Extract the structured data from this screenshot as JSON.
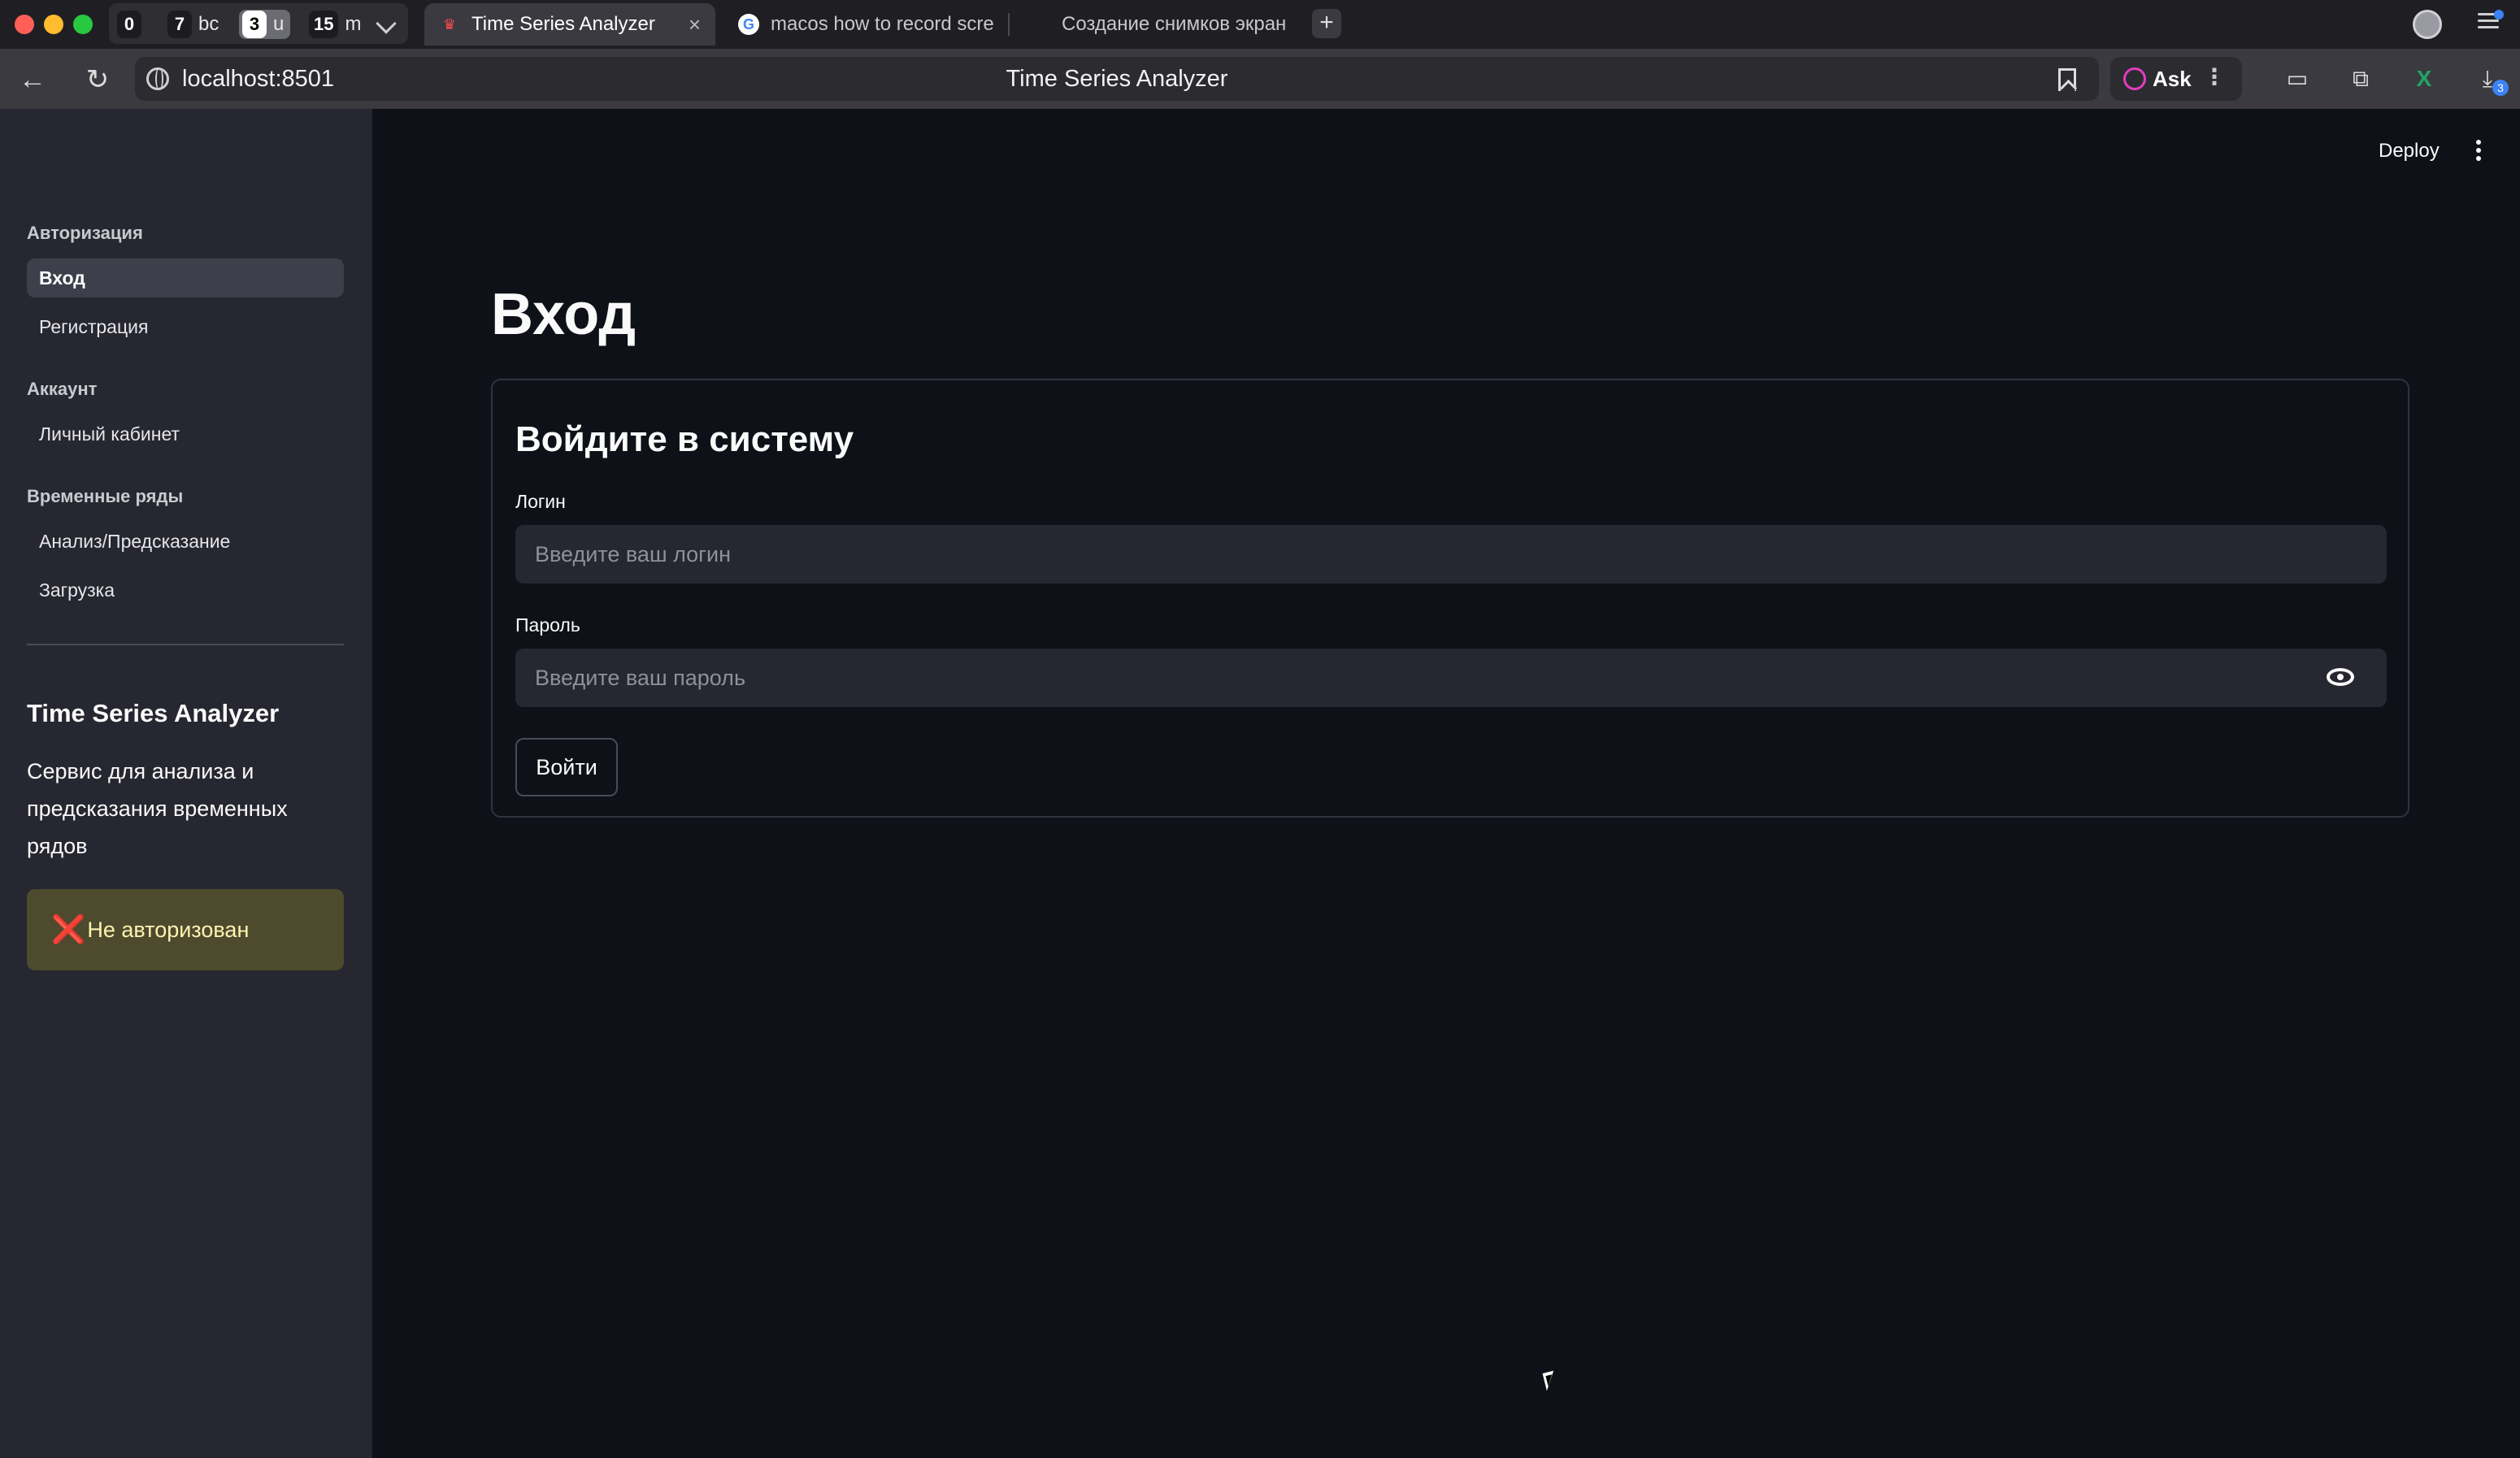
{
  "browser": {
    "tab_groups": [
      {
        "count": "0",
        "label": ""
      },
      {
        "count": "7",
        "label": "bc"
      },
      {
        "count": "3",
        "label": "u"
      },
      {
        "count": "15",
        "label": "m"
      }
    ],
    "tabs": [
      {
        "title": "Time Series Analyzer",
        "close": "×"
      },
      {
        "title": "macos how to record scre"
      },
      {
        "title": "Создание снимков экран"
      }
    ],
    "new_tab": "+",
    "url": "localhost:8501",
    "page_title": "Time Series Analyzer",
    "ask_label": "Ask",
    "ask_more": "⋮",
    "downloads_badge": "3"
  },
  "sidebar": {
    "sections": [
      {
        "title": "Авторизация",
        "items": [
          {
            "label": "Вход",
            "active": true
          },
          {
            "label": "Регистрация"
          }
        ]
      },
      {
        "title": "Аккаунт",
        "items": [
          {
            "label": "Личный кабинет"
          }
        ]
      },
      {
        "title": "Временные ряды",
        "items": [
          {
            "label": "Анализ/Предсказание"
          },
          {
            "label": "Загрузка"
          }
        ]
      }
    ],
    "app_title": "Time Series Analyzer",
    "app_description": "Сервис для анализа и предсказания временных рядов",
    "status": {
      "icon": "❌",
      "text": "Не авторизован"
    }
  },
  "header": {
    "deploy_label": "Deploy"
  },
  "main": {
    "heading": "Вход",
    "form": {
      "title": "Войдите в систему",
      "login_label": "Логин",
      "login_placeholder": "Введите ваш логин",
      "password_label": "Пароль",
      "password_placeholder": "Введите ваш пароль",
      "submit_label": "Войти"
    }
  },
  "colors": {
    "background": "#0e1117",
    "sidebar": "#262730",
    "input": "#262730",
    "status_warning_bg": "#4d4a2e",
    "status_warning_text": "#fff3b0",
    "error_icon": "#e4312b"
  }
}
